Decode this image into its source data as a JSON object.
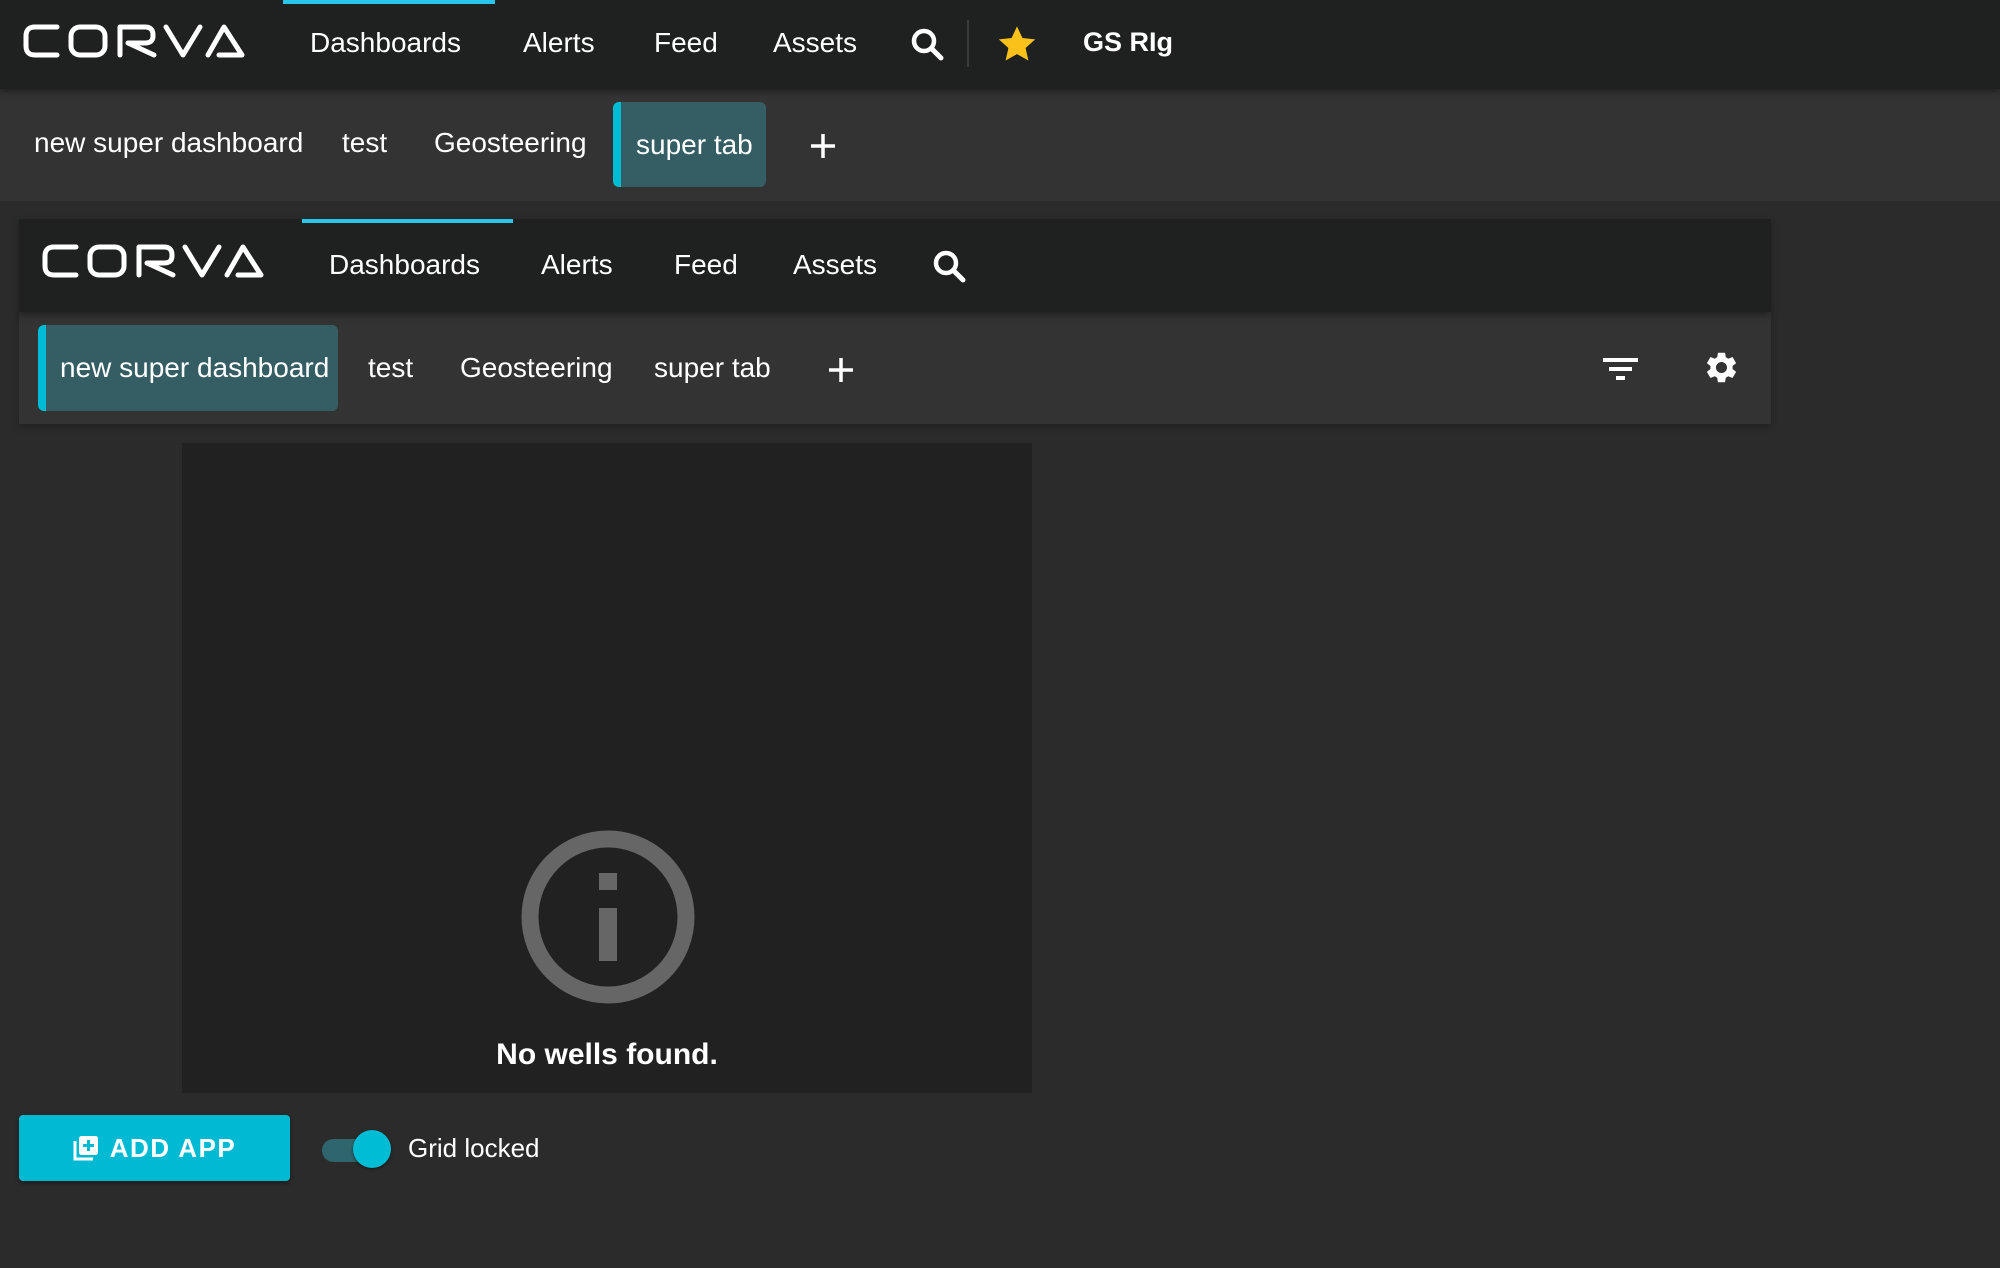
{
  "outer": {
    "brand": "CORVA",
    "nav": {
      "items": [
        {
          "label": "Dashboards",
          "active": true
        },
        {
          "label": "Alerts",
          "active": false
        },
        {
          "label": "Feed",
          "active": false
        },
        {
          "label": "Assets",
          "active": false
        }
      ],
      "search_icon": "search-icon",
      "favorite_icon": "star-icon",
      "rig_name": "GS RIg"
    },
    "tabs": {
      "items": [
        {
          "label": "new super dashboard",
          "active": false
        },
        {
          "label": "test",
          "active": false
        },
        {
          "label": "Geosteering",
          "active": false
        },
        {
          "label": "super tab",
          "active": true
        }
      ],
      "add_icon": "plus-icon"
    }
  },
  "inner": {
    "brand": "CORVA",
    "nav": {
      "items": [
        {
          "label": "Dashboards",
          "active": true
        },
        {
          "label": "Alerts",
          "active": false
        },
        {
          "label": "Feed",
          "active": false
        },
        {
          "label": "Assets",
          "active": false
        }
      ],
      "search_icon": "search-icon"
    },
    "tabs": {
      "items": [
        {
          "label": "new super dashboard",
          "active": true
        },
        {
          "label": "test",
          "active": false
        },
        {
          "label": "Geosteering",
          "active": false
        },
        {
          "label": "super tab",
          "active": false
        }
      ],
      "add_icon": "plus-icon",
      "filter_icon": "filter-icon",
      "settings_icon": "gear-icon"
    }
  },
  "panel": {
    "icon": "info-icon",
    "message": "No wells found."
  },
  "footer": {
    "add_app_label": "ADD APP",
    "add_app_icon": "library-add-icon",
    "grid_locked_label": "Grid locked",
    "grid_locked": true
  },
  "colors": {
    "accent": "#00bcd4",
    "nav_indicator": "#29c5ea",
    "active_tab_bg": "#355e64",
    "favorite": "#f9c11a",
    "topbar_bg": "#1f2020",
    "tabbar_bg": "#333333",
    "page_bg": "#2b2b2b",
    "panel_bg": "#212121"
  }
}
